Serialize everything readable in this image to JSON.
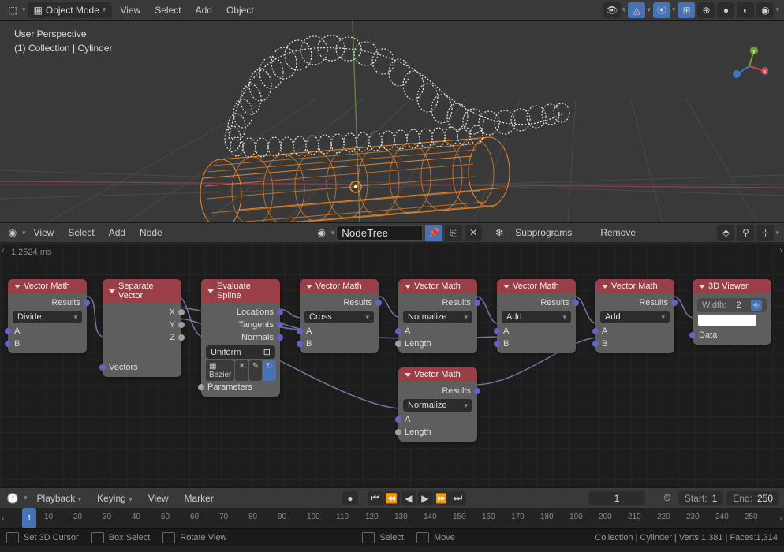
{
  "header3d": {
    "mode": "Object Mode",
    "menus": [
      "View",
      "Select",
      "Add",
      "Object"
    ]
  },
  "viewport": {
    "perspective": "User Perspective",
    "path": "(1) Collection | Cylinder"
  },
  "nodeHeader": {
    "menus": [
      "View",
      "Select",
      "Add",
      "Node"
    ],
    "treeName": "NodeTree",
    "subprograms": "Subprograms",
    "remove": "Remove"
  },
  "timing": "1.2524 ms",
  "nodes": {
    "vm1": {
      "title": "Vector Math",
      "results": "Results",
      "op": "Divide",
      "a": "A",
      "b": "B"
    },
    "sep": {
      "title": "Separate Vector",
      "x": "X",
      "y": "Y",
      "z": "Z",
      "vectors": "Vectors"
    },
    "eval": {
      "title": "Evaluate Spline",
      "locations": "Locations",
      "tangents": "Tangents",
      "normals": "Normals",
      "resolution": "Uniform",
      "spline": "Bezier",
      "params": "Parameters"
    },
    "vm2": {
      "title": "Vector Math",
      "results": "Results",
      "op": "Cross",
      "a": "A",
      "b": "B"
    },
    "vm3": {
      "title": "Vector Math",
      "results": "Results",
      "op": "Normalize",
      "a": "A",
      "length": "Length"
    },
    "vm3b": {
      "title": "Vector Math",
      "results": "Results",
      "op": "Normalize",
      "a": "A",
      "length": "Length"
    },
    "vm4": {
      "title": "Vector Math",
      "results": "Results",
      "op": "Add",
      "a": "A",
      "b": "B"
    },
    "vm5": {
      "title": "Vector Math",
      "results": "Results",
      "op": "Add",
      "a": "A",
      "b": "B"
    },
    "viewer": {
      "title": "3D Viewer",
      "widthLabel": "Width:",
      "widthVal": "2",
      "data": "Data"
    }
  },
  "timeline": {
    "playback": "Playback",
    "keying": "Keying",
    "view": "View",
    "marker": "Marker",
    "currentFrame": "1",
    "startLabel": "Start:",
    "startVal": "1",
    "endLabel": "End:",
    "endVal": "250",
    "ticks": [
      "10",
      "20",
      "30",
      "40",
      "50",
      "60",
      "70",
      "80",
      "90",
      "100",
      "110",
      "120",
      "130",
      "140",
      "150",
      "160",
      "170",
      "180",
      "190",
      "200",
      "210",
      "220",
      "230",
      "240",
      "250"
    ]
  },
  "statusbar": {
    "cursor": "Set 3D Cursor",
    "box": "Box Select",
    "rotate": "Rotate View",
    "select": "Select",
    "move": "Move",
    "stats": "Collection | Cylinder | Verts:1,381 | Faces:1,314"
  }
}
